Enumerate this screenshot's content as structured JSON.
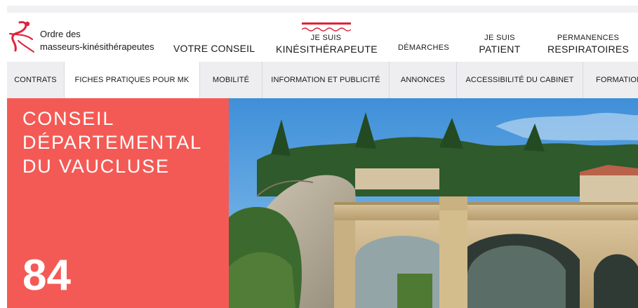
{
  "header": {
    "brand_line1": "Ordre des",
    "brand_line2": "masseurs-kinésithérapeutes",
    "nav": {
      "votre_conseil": "VOTRE CONSEIL",
      "kine_small": "JE SUIS",
      "kine_big": "KINÉSITHÉRAPEUTE",
      "demarches": "DÉMARCHES",
      "patient_small": "JE SUIS",
      "patient_big": "PATIENT",
      "perm_small": "PERMANENCES",
      "perm_big": "RESPIRATOIRES"
    },
    "active_nav": "JE SUIS KINÉSITHÉRAPEUTE"
  },
  "subnav": {
    "items": [
      {
        "label": "CONTRATS"
      },
      {
        "label": "FICHES PRATIQUES POUR MK"
      },
      {
        "label": "MOBILITÉ"
      },
      {
        "label": "INFORMATION ET PUBLICITÉ"
      },
      {
        "label": "ANNONCES"
      },
      {
        "label": "ACCESSIBILITÉ DU CABINET"
      },
      {
        "label": "FORMATION"
      }
    ],
    "active_index": 1
  },
  "hero": {
    "title_line1": "CONSEIL",
    "title_line2": "DÉPARTEMENTAL",
    "title_line3": "DU VAUCLUSE",
    "number": "84"
  },
  "colors": {
    "accent": "#f45a55",
    "brand_red": "#e0233a",
    "subnav_bg": "#eeeef0"
  },
  "icons": {
    "logo": "dancer-figure-logo",
    "active_indicator": "wavy-underline"
  }
}
